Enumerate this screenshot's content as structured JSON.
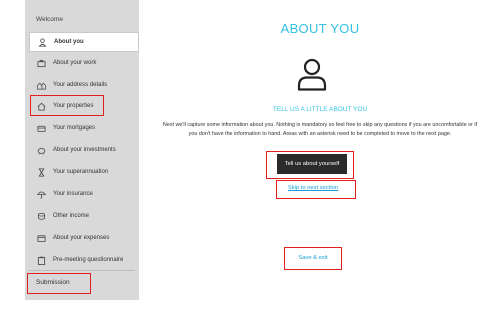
{
  "sidebar": {
    "welcome": "Welcome",
    "items": [
      {
        "label": "About you",
        "icon": "person-icon"
      },
      {
        "label": "About your work",
        "icon": "briefcase-icon"
      },
      {
        "label": "Your address details",
        "icon": "houses-icon"
      },
      {
        "label": "Your properties",
        "icon": "home-icon"
      },
      {
        "label": "Your mortgages",
        "icon": "wallet-icon"
      },
      {
        "label": "About your investments",
        "icon": "piggy-bank-icon"
      },
      {
        "label": "Your superannuation",
        "icon": "hourglass-icon"
      },
      {
        "label": "Your insurance",
        "icon": "umbrella-icon"
      },
      {
        "label": "Other income",
        "icon": "coins-icon"
      },
      {
        "label": "About your expenses",
        "icon": "card-icon"
      },
      {
        "label": "Pre-meeting questionnaire",
        "icon": "clipboard-icon"
      }
    ],
    "submission": "Submission"
  },
  "main": {
    "title": "ABOUT YOU",
    "subtitle": "TELL US A LITTLE ABOUT YOU",
    "description": "Next we'll capture some information about you. Nothing is mandatory so feel free to skip any questions if you are uncomfortable or if you don't have the information to hand. Areas with an asterisk need to be completed to move to the next page.",
    "primary_button": "Tell us about yourself",
    "skip_link": "Skip to next section",
    "save_link": "Save & exit"
  },
  "colors": {
    "accent": "#34c2e4",
    "link": "#1a9fd6",
    "sidebar_bg": "#d9d9d9",
    "button_bg": "#2b2b2b",
    "highlight_border": "#e0201c"
  }
}
